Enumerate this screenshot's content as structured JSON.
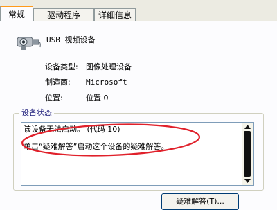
{
  "tabs": [
    {
      "label": "常规",
      "active": true
    },
    {
      "label": "驱动程序",
      "active": false
    },
    {
      "label": "详细信息",
      "active": false
    }
  ],
  "device": {
    "icon": "webcam-icon",
    "name": "USB 视频设备"
  },
  "properties": {
    "type_label": "设备类型:",
    "type_value": "图像处理设备",
    "manufacturer_label": "制造商:",
    "manufacturer_value": "Microsoft",
    "location_label": "位置:",
    "location_value": "位置 0"
  },
  "status": {
    "group_title": "设备状态",
    "line1": "该设备无法启动。 (代码 10)",
    "line2": "单击“疑难解答”启动这个设备的疑难解答。"
  },
  "buttons": {
    "troubleshoot": "疑难解答(T)..."
  },
  "colors": {
    "highlight_ellipse": "#e0202a",
    "active_tab_accent": "#ff9a1a"
  }
}
